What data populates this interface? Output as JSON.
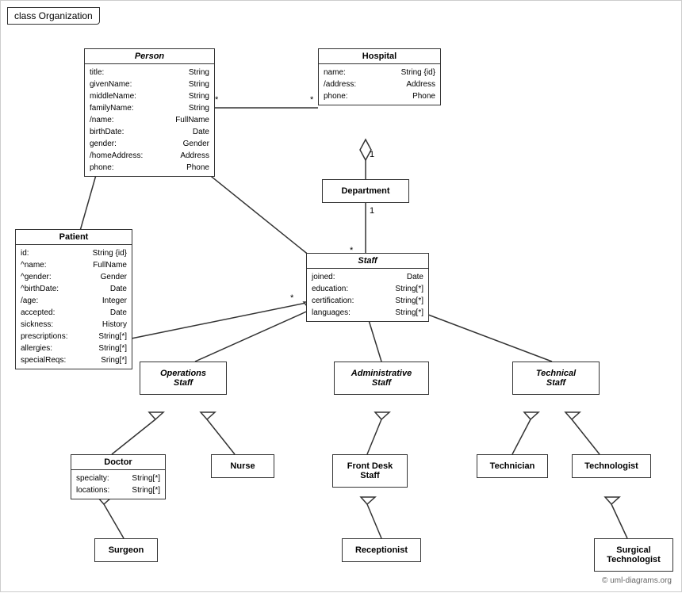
{
  "title": "class Organization",
  "copyright": "© uml-diagrams.org",
  "boxes": {
    "person": {
      "title": "Person",
      "italic": true,
      "attrs": [
        [
          "title:",
          "String"
        ],
        [
          "givenName:",
          "String"
        ],
        [
          "middleName:",
          "String"
        ],
        [
          "familyName:",
          "String"
        ],
        [
          "/name:",
          "FullName"
        ],
        [
          "birthDate:",
          "Date"
        ],
        [
          "gender:",
          "Gender"
        ],
        [
          "/homeAddress:",
          "Address"
        ],
        [
          "phone:",
          "Phone"
        ]
      ]
    },
    "hospital": {
      "title": "Hospital",
      "italic": false,
      "attrs": [
        [
          "name:",
          "String {id}"
        ],
        [
          "/address:",
          "Address"
        ],
        [
          "phone:",
          "Phone"
        ]
      ]
    },
    "patient": {
      "title": "Patient",
      "italic": false,
      "attrs": [
        [
          "id:",
          "String {id}"
        ],
        [
          "^name:",
          "FullName"
        ],
        [
          "^gender:",
          "Gender"
        ],
        [
          "^birthDate:",
          "Date"
        ],
        [
          "/age:",
          "Integer"
        ],
        [
          "accepted:",
          "Date"
        ],
        [
          "sickness:",
          "History"
        ],
        [
          "prescriptions:",
          "String[*]"
        ],
        [
          "allergies:",
          "String[*]"
        ],
        [
          "specialReqs:",
          "Sring[*]"
        ]
      ]
    },
    "department": {
      "title": "Department",
      "italic": false,
      "attrs": []
    },
    "staff": {
      "title": "Staff",
      "italic": true,
      "attrs": [
        [
          "joined:",
          "Date"
        ],
        [
          "education:",
          "String[*]"
        ],
        [
          "certification:",
          "String[*]"
        ],
        [
          "languages:",
          "String[*]"
        ]
      ]
    },
    "operations_staff": {
      "title": "Operations\nStaff",
      "italic": true,
      "attrs": []
    },
    "administrative_staff": {
      "title": "Administrative\nStaff",
      "italic": true,
      "attrs": []
    },
    "technical_staff": {
      "title": "Technical\nStaff",
      "italic": true,
      "attrs": []
    },
    "doctor": {
      "title": "Doctor",
      "italic": false,
      "attrs": [
        [
          "specialty:",
          "String[*]"
        ],
        [
          "locations:",
          "String[*]"
        ]
      ]
    },
    "nurse": {
      "title": "Nurse",
      "italic": false,
      "attrs": []
    },
    "front_desk_staff": {
      "title": "Front Desk\nStaff",
      "italic": false,
      "attrs": []
    },
    "technician": {
      "title": "Technician",
      "italic": false,
      "attrs": []
    },
    "technologist": {
      "title": "Technologist",
      "italic": false,
      "attrs": []
    },
    "surgeon": {
      "title": "Surgeon",
      "italic": false,
      "attrs": []
    },
    "receptionist": {
      "title": "Receptionist",
      "italic": false,
      "attrs": []
    },
    "surgical_technologist": {
      "title": "Surgical\nTechnologist",
      "italic": false,
      "attrs": []
    }
  }
}
